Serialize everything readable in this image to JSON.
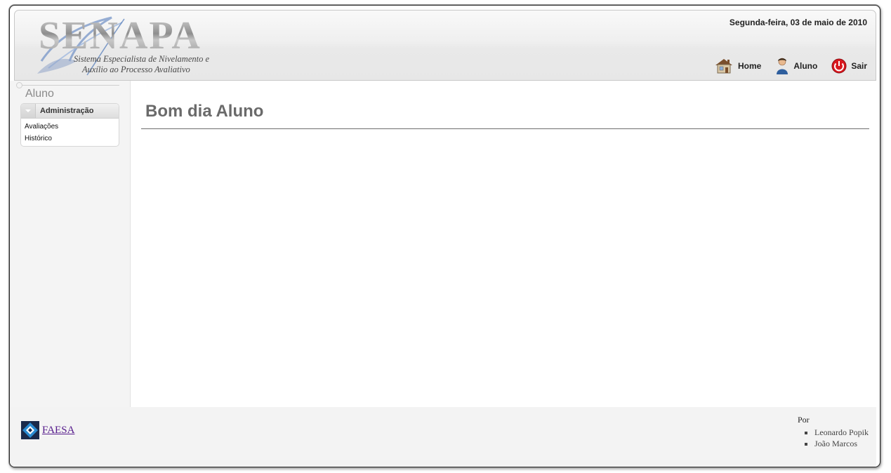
{
  "header": {
    "logo_title": "SENAPA",
    "logo_subtitle_line1": "Sistema Especialista de Nivelamento e",
    "logo_subtitle_line2": "Auxílio ao Processo Avaliativo",
    "date": "Segunda-feira, 03 de maio de 2010",
    "nav": [
      {
        "label": "Home",
        "icon": "house-icon"
      },
      {
        "label": "Aluno",
        "icon": "user-icon"
      },
      {
        "label": "Sair",
        "icon": "power-icon"
      }
    ]
  },
  "sidebar": {
    "title": "Aluno",
    "panel": {
      "label": "Administração",
      "items": [
        "Avaliações",
        "Histórico"
      ]
    }
  },
  "main": {
    "greeting": "Bom dia Aluno"
  },
  "footer": {
    "link": "FAESA",
    "credits_label": "Por",
    "authors": [
      "Leonardo Popik",
      "João Marcos"
    ]
  },
  "colors": {
    "accent_link": "#551a8b",
    "power_red": "#d9181f",
    "user_blue": "#2f5f9e"
  }
}
